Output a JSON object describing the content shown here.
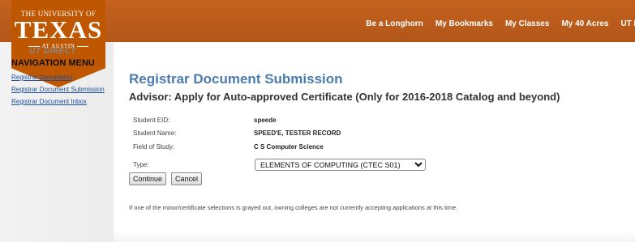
{
  "topnav": {
    "items": [
      "Be a Longhorn",
      "My Bookmarks",
      "My Classes",
      "My 40 Acres",
      "UT Dire"
    ]
  },
  "logo": {
    "line1": "THE UNIVERSITY OF",
    "line2": "TEXAS",
    "line3": "AT AUSTIN"
  },
  "sidebar": {
    "brand": "UT DIRECT",
    "title": "NAVIGATION MENU",
    "links": [
      "Registrar Documents",
      "Registrar Document Submission",
      "Registrar Document Inbox"
    ]
  },
  "main": {
    "title": "Registrar Document Submission",
    "subtitle": "Advisor: Apply for Auto-approved Certificate (Only for 2016-2018 Catalog and beyond)",
    "fields": [
      {
        "label": "Student EID:",
        "value": "speede"
      },
      {
        "label": "Student Name:",
        "value": "SPEED'E, TESTER RECORD"
      },
      {
        "label": "Field of Study:",
        "value": "C S Computer Science"
      }
    ],
    "type_label": "Type:",
    "type_selected": "ELEMENTS OF COMPUTING (CTEC S01)",
    "continue_label": "Continue",
    "cancel_label": "Cancel",
    "note": "If one of the minor/certificate selections is grayed out, owning colleges are not currently accepting applications at this time."
  },
  "colors": {
    "banner": "#b2561a",
    "logo": "#bf5700",
    "title": "#4a7cb0",
    "link": "#1f4e9c"
  }
}
